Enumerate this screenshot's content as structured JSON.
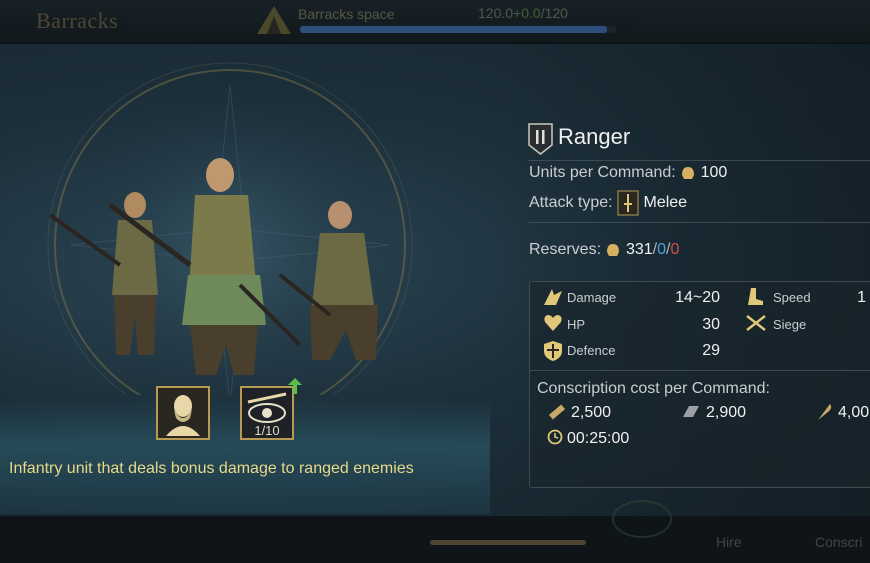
{
  "topbar": {
    "title": "Barracks",
    "space_label": "Barracks space",
    "space_value": "120.0",
    "space_bonus": "+0.0",
    "space_max": "120",
    "space_fill_pct": 97
  },
  "unit": {
    "name": "Ranger",
    "class_icon": "shield-rank-II-icon",
    "units_per_command_label": "Units per Command:",
    "units_per_command_value": "100",
    "attack_type_label": "Attack type:",
    "attack_type_value": "Melee",
    "reserves_label": "Reserves:",
    "reserves_value": "331",
    "reserves_blue": "0",
    "reserves_red": "0",
    "description": "Infantry unit that deals bonus damage to ranged enemies"
  },
  "badges": {
    "commander_icon": "bearded-commander-portrait-icon",
    "skill_level": "1/10",
    "skill_icon": "eye-slash-skill-icon"
  },
  "stats": {
    "damage_label": "Damage",
    "damage_value": "14~20",
    "hp_label": "HP",
    "hp_value": "30",
    "defence_label": "Defence",
    "defence_value": "29",
    "speed_label": "Speed",
    "speed_value": "1",
    "siege_label": "Siege"
  },
  "conscription": {
    "title": "Conscription cost per Command:",
    "wood": "2,500",
    "iron": "2,900",
    "third": "4,00",
    "time": "00:25:00"
  },
  "bottom": {
    "hire_label": "Hire",
    "conscript_label": "Conscri"
  },
  "colors": {
    "gold": "#e7d98a",
    "blue": "#4aa3e0",
    "red": "#d84b4b"
  }
}
